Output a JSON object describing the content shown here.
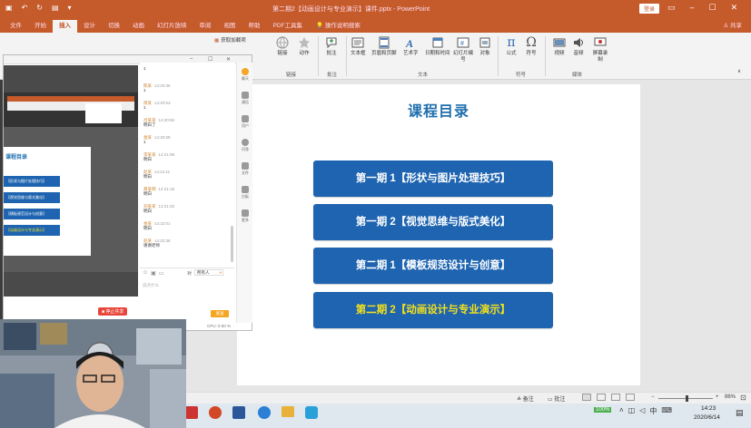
{
  "window": {
    "title": "第二期2【动画设计与专业演示】课件.pptx - PowerPoint",
    "login_label": "登录",
    "share_label": "共享",
    "tell_me": "操作说明搜索"
  },
  "tabs": [
    {
      "label": "文件",
      "active": false
    },
    {
      "label": "开始",
      "active": false
    },
    {
      "label": "插入",
      "active": true
    },
    {
      "label": "设计",
      "active": false
    },
    {
      "label": "切换",
      "active": false
    },
    {
      "label": "动画",
      "active": false
    },
    {
      "label": "幻灯片放映",
      "active": false
    },
    {
      "label": "审阅",
      "active": false
    },
    {
      "label": "视图",
      "active": false
    },
    {
      "label": "帮助",
      "active": false
    },
    {
      "label": "PDF工具集",
      "active": false
    }
  ],
  "ribbon": {
    "addin_label": "获取加载项",
    "buttons": {
      "link": "链接",
      "action": "动作",
      "comment": "批注",
      "textbox": "文本框",
      "header_footer": "页眉和页脚",
      "wordart": "艺术字",
      "datetime": "日期和时间",
      "slide_number": "幻灯片编号",
      "object": "对象",
      "equation": "公式",
      "symbol": "符号",
      "video": "视频",
      "audio": "音频",
      "screen_recording": "屏幕录制"
    },
    "groups": {
      "links": "链接",
      "comments": "批注",
      "text": "文本",
      "symbols": "符号",
      "media": "媒体"
    }
  },
  "slide": {
    "title": "课程目录",
    "items": [
      {
        "label": "第一期 1【形状与图片处理技巧】",
        "highlight": false
      },
      {
        "label": "第一期 2【视觉思维与版式美化】",
        "highlight": false
      },
      {
        "label": "第二期 1【模板规范设计与创意】",
        "highlight": false
      },
      {
        "label": "第二期 2【动画设计与专业演示】",
        "highlight": true
      }
    ],
    "colors": {
      "button": "#1e64b0",
      "title": "#1f6fae",
      "highlight_text": "#f5e11a"
    }
  },
  "statusbar": {
    "notes": "备注",
    "comments": "批注",
    "zoom": "86%"
  },
  "share_window": {
    "thumb_title": "课程目录",
    "thumb_items": [
      "【形状与图片处理技巧】",
      "【视觉思维与版式美化】",
      "【模板规范设计与创意】",
      "【动画设计与专业演示】"
    ],
    "stop_share": "停止共享",
    "messages": [
      {
        "name": "",
        "time": "",
        "text": "1"
      },
      {
        "name": "陈某",
        "time": "14:20:36",
        "text": "1"
      },
      {
        "name": "周某",
        "time": "14:20:53",
        "text": "1"
      },
      {
        "name": "吕某某",
        "time": "14:20:56",
        "text": "明白了"
      },
      {
        "name": "金某",
        "time": "14:20:58",
        "text": "1"
      },
      {
        "name": "李某某",
        "time": "14:21:08",
        "text": "明白"
      },
      {
        "name": "赵某",
        "time": "14:21:11",
        "text": "明白"
      },
      {
        "name": "黄某明",
        "time": "14:21:18",
        "text": "明白"
      },
      {
        "name": "刘某某",
        "time": "14:21:33",
        "text": "明白"
      },
      {
        "name": "金某",
        "time": "14:22:01",
        "text": "明白"
      },
      {
        "name": "赵某",
        "time": "14:22:38",
        "text": "谢谢老师"
      }
    ],
    "recipient": "所有人",
    "input_placeholder": "说点什么",
    "send": "发送",
    "cpu": "CPU: 0.00 %",
    "rail": [
      "聊天",
      "通话",
      "用户",
      "问答",
      "文件",
      "白板",
      "更多"
    ]
  },
  "taskbar": {
    "time": "14:23",
    "date": "2020/6/14",
    "battery": "100%"
  }
}
